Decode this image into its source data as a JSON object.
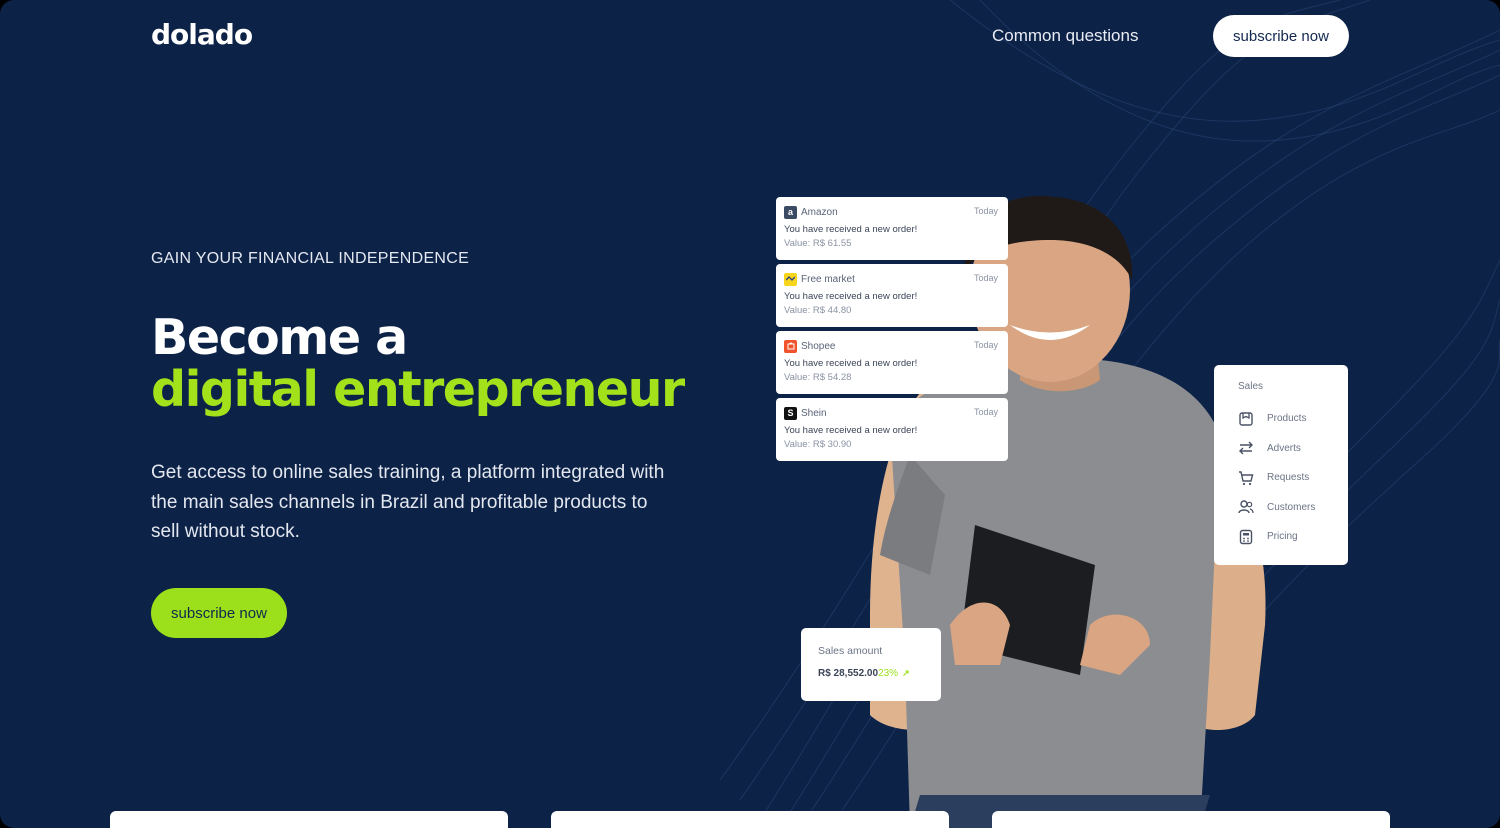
{
  "header": {
    "logo": "dolado",
    "nav_link": "Common questions",
    "nav_button": "subscribe now"
  },
  "hero": {
    "eyebrow": "GAIN YOUR FINANCIAL INDEPENDENCE",
    "title_line1": "Become a",
    "title_line2": "digital entrepreneur",
    "description": "Get access to online sales training, a platform integrated with the main sales channels in Brazil and profitable products to sell without stock.",
    "cta": "subscribe now"
  },
  "notifications": [
    {
      "channel": "Amazon",
      "icon": "amazon-icon",
      "color": "#3b4b63",
      "glyph": "a",
      "time": "Today",
      "message": "You have received a new order!",
      "value": "Value: R$ 61.55"
    },
    {
      "channel": "Free market",
      "icon": "mercado-livre-icon",
      "color": "#f7d51d",
      "glyph": "",
      "time": "Today",
      "message": "You have received a new order!",
      "value": "Value: R$ 44.80"
    },
    {
      "channel": "Shopee",
      "icon": "shopee-icon",
      "color": "#f1532d",
      "glyph": "",
      "time": "Today",
      "message": "You have received a new order!",
      "value": "Value: R$ 54.28"
    },
    {
      "channel": "Shein",
      "icon": "shein-icon",
      "color": "#111111",
      "glyph": "S",
      "time": "Today",
      "message": "You have received a new order!",
      "value": "Value: R$ 30.90"
    }
  ],
  "sales_menu": {
    "title": "Sales",
    "items": [
      {
        "label": "Products",
        "icon": "products-icon"
      },
      {
        "label": "Adverts",
        "icon": "swap-arrows-icon"
      },
      {
        "label": "Requests",
        "icon": "cart-icon"
      },
      {
        "label": "Customers",
        "icon": "users-icon"
      },
      {
        "label": "Pricing",
        "icon": "calculator-icon"
      }
    ]
  },
  "sales_amount": {
    "label": "Sales amount",
    "value": "R$ 28,552.00",
    "change": "23%"
  },
  "colors": {
    "background": "#0d2247",
    "accent": "#9be01a",
    "headline_green": "#a3e21b"
  }
}
